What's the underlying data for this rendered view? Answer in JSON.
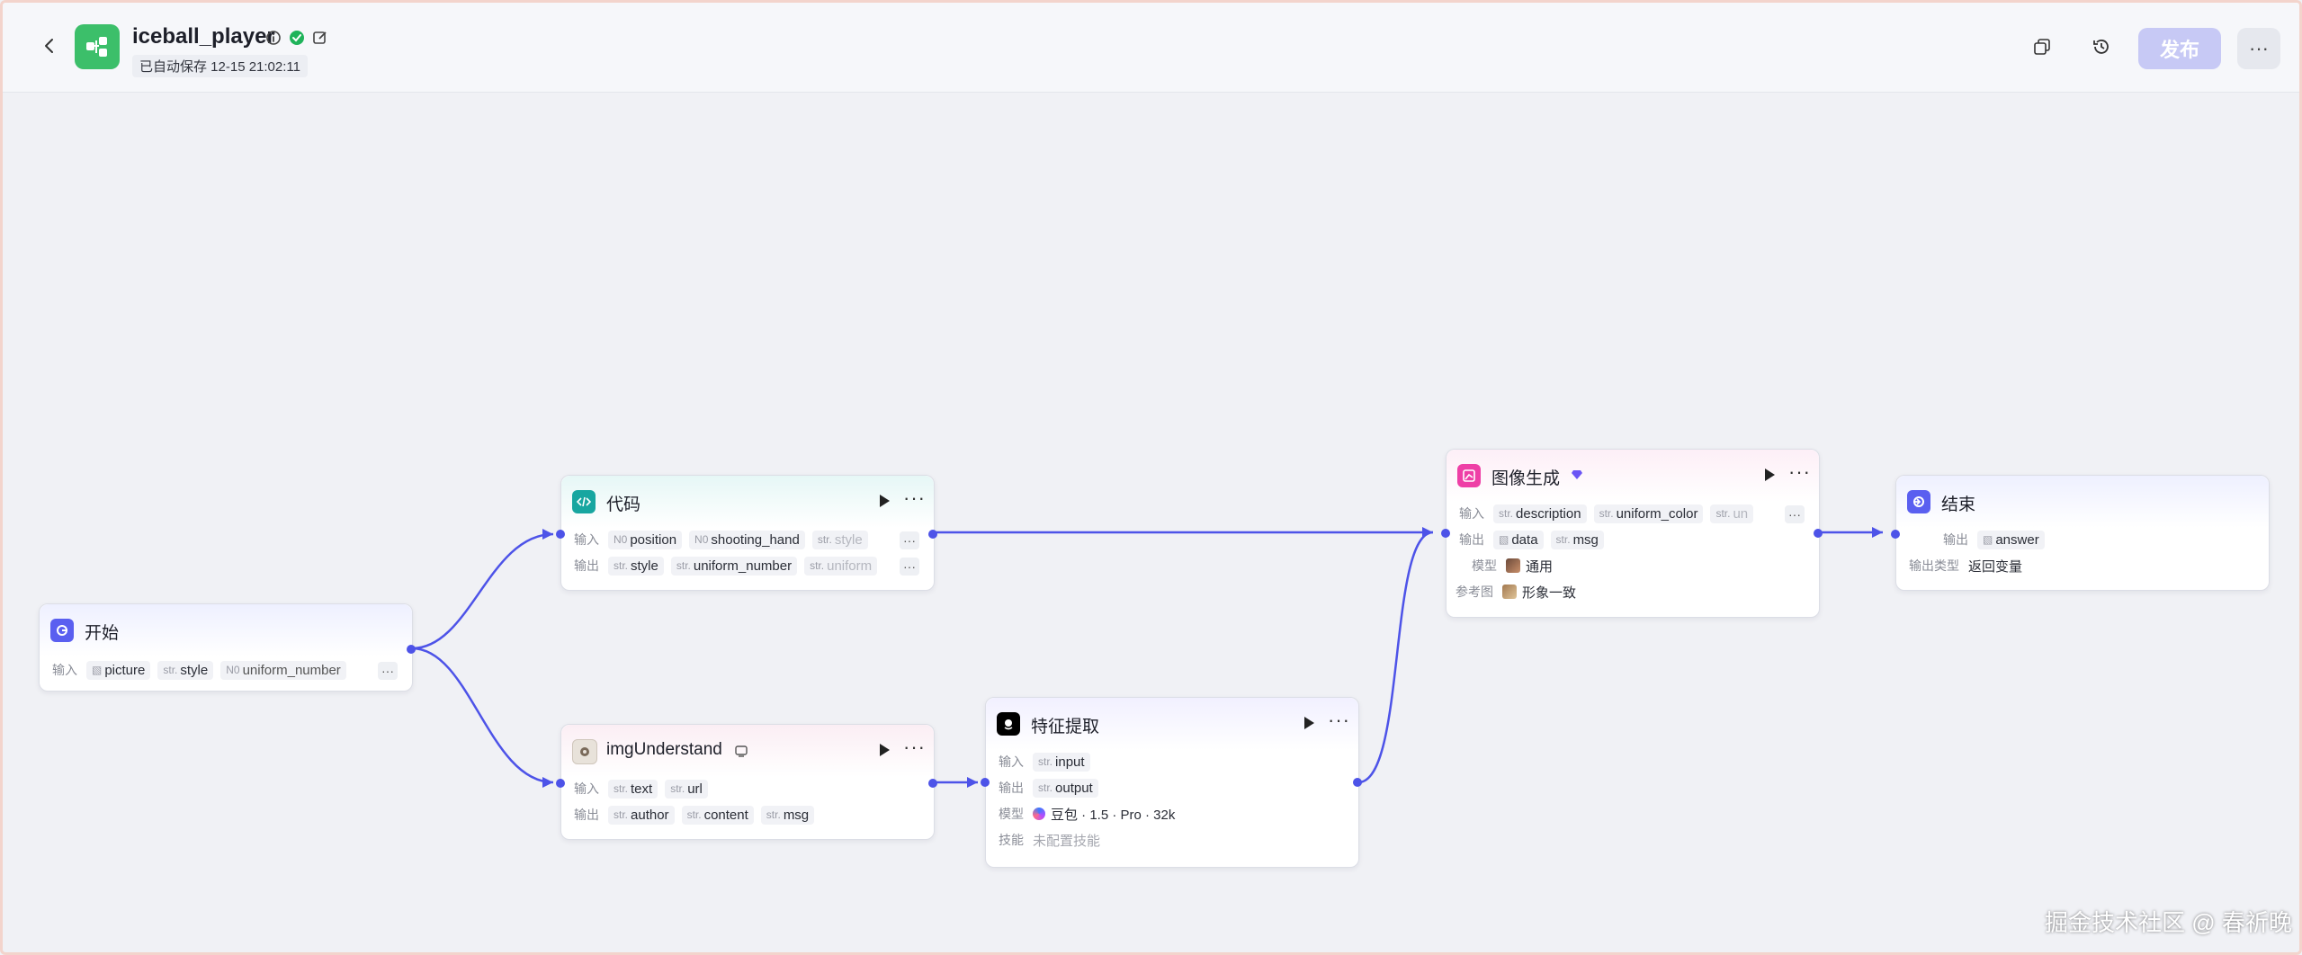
{
  "header": {
    "title": "iceball_player",
    "autosave": "已自动保存 12-15 21:02:11",
    "publish_label": "发布",
    "more_label": "···"
  },
  "colors": {
    "accent": "#4d53e8",
    "app_icon": "#3cbf6a",
    "publish_disabled": "#c7c9f5"
  },
  "nodes": {
    "start": {
      "title": "开始",
      "input_label": "输入",
      "inputs": [
        {
          "type": "img",
          "name": "picture"
        },
        {
          "type": "str.",
          "name": "style"
        },
        {
          "type": "N0",
          "name": "uniform_number"
        }
      ]
    },
    "code": {
      "title": "代码",
      "input_label": "输入",
      "output_label": "输出",
      "inputs": [
        {
          "type": "N0",
          "name": "position"
        },
        {
          "type": "N0",
          "name": "shooting_hand"
        },
        {
          "type": "str.",
          "name": "style"
        }
      ],
      "outputs": [
        {
          "type": "str.",
          "name": "style"
        },
        {
          "type": "str.",
          "name": "uniform_number"
        },
        {
          "type": "str.",
          "name": "uniform"
        }
      ]
    },
    "img_understand": {
      "title": "imgUnderstand",
      "input_label": "输入",
      "output_label": "输出",
      "inputs": [
        {
          "type": "str.",
          "name": "text"
        },
        {
          "type": "str.",
          "name": "url"
        }
      ],
      "outputs": [
        {
          "type": "str.",
          "name": "author"
        },
        {
          "type": "str.",
          "name": "content"
        },
        {
          "type": "str.",
          "name": "msg"
        }
      ]
    },
    "feature": {
      "title": "特征提取",
      "input_label": "输入",
      "output_label": "输出",
      "model_label": "模型",
      "skill_label": "技能",
      "input": {
        "type": "str.",
        "name": "input"
      },
      "output": {
        "type": "str.",
        "name": "output"
      },
      "model": "豆包 · 1.5 · Pro · 32k",
      "skill": "未配置技能"
    },
    "image_gen": {
      "title": "图像生成",
      "input_label": "输入",
      "output_label": "输出",
      "model_label": "模型",
      "ref_label": "参考图",
      "inputs": [
        {
          "type": "str.",
          "name": "description"
        },
        {
          "type": "str.",
          "name": "uniform_color"
        },
        {
          "type": "str.",
          "name": "un"
        }
      ],
      "outputs": [
        {
          "type": "img",
          "name": "data"
        },
        {
          "type": "str.",
          "name": "msg"
        }
      ],
      "model": "通用",
      "ref": "形象一致"
    },
    "end": {
      "title": "结束",
      "output_label": "输出",
      "output_type_label": "输出类型",
      "output": {
        "type": "img",
        "name": "answer"
      },
      "output_type": "返回变量"
    }
  },
  "watermark": "掘金技术社区 @ 春祈晚"
}
